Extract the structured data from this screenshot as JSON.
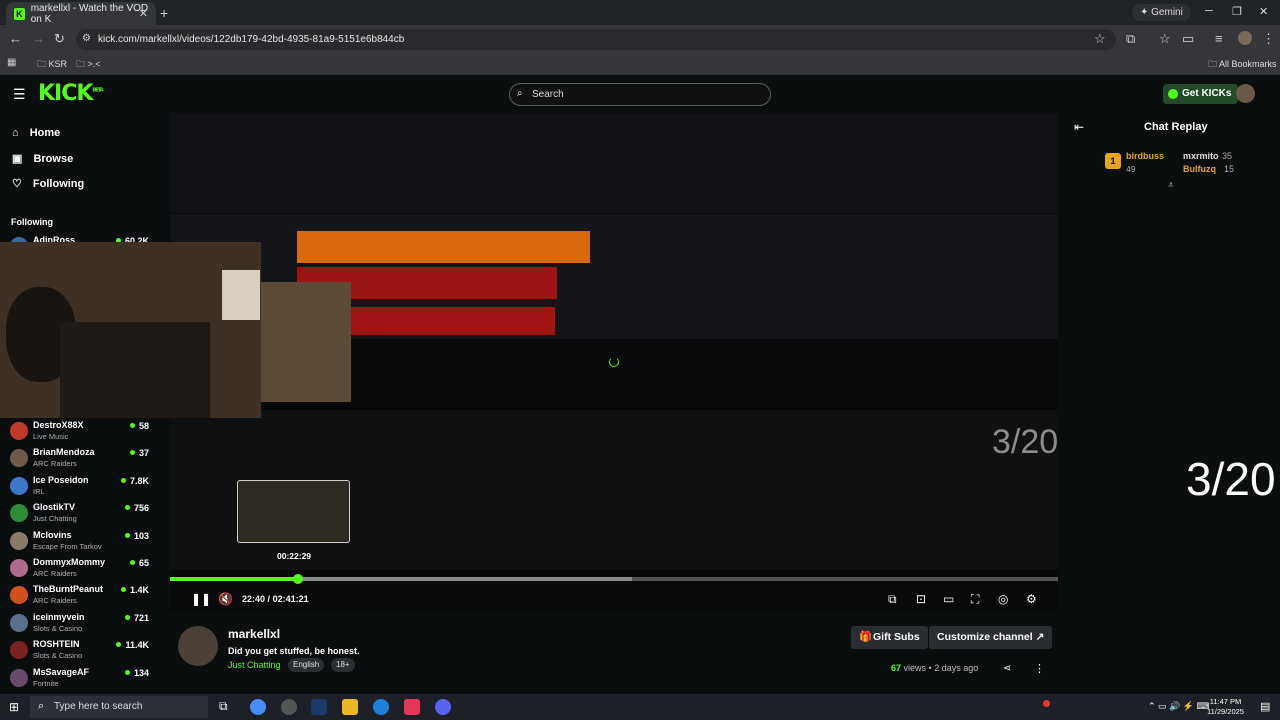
{
  "browser": {
    "tab_title": "markellxl - Watch the VOD on K",
    "tab_favicon": "K",
    "new_tab": "+",
    "gemini": "✦ Gemini",
    "url": "kick.com/markellxl/videos/122db179-42bd-4935-81a9-5151e6b844cb",
    "bookmarks": [
      "KSR",
      ">.<"
    ],
    "all_bookmarks": "All Bookmarks"
  },
  "kick": {
    "logo": "KICK",
    "logo_badge": "BETA",
    "search_placeholder": "Search",
    "get_kicks": "Get KICKs"
  },
  "sidebar": {
    "nav": [
      {
        "label": "Home",
        "icon": "home-icon"
      },
      {
        "label": "Browse",
        "icon": "browse-icon"
      },
      {
        "label": "Following",
        "icon": "heart-icon"
      }
    ],
    "section_title": "Following",
    "first_partial": {
      "name": "AdinRoss",
      "viewers": "60.2K"
    },
    "following": [
      {
        "name": "DestroX88X",
        "category": "Live Music",
        "viewers": "58",
        "color": "#c0392b"
      },
      {
        "name": "BrianMendoza",
        "category": "ARC Raiders",
        "viewers": "37",
        "color": "#6d5a4a"
      },
      {
        "name": "Ice Poseidon",
        "category": "IRL",
        "viewers": "7.8K",
        "color": "#3d78c9"
      },
      {
        "name": "GlostikTV",
        "category": "Just Chatting",
        "viewers": "756",
        "color": "#2e8b3a"
      },
      {
        "name": "Mclovins",
        "category": "Escape From Tarkov",
        "viewers": "103",
        "color": "#8a7a6a"
      },
      {
        "name": "DommyxMommy",
        "category": "ARC Raiders",
        "viewers": "65",
        "color": "#b06a8a"
      },
      {
        "name": "TheBurntPeanut",
        "category": "ARC Raiders",
        "viewers": "1.4K",
        "color": "#d0511e"
      },
      {
        "name": "iceinmyvein",
        "category": "Slots & Casino",
        "viewers": "721",
        "color": "#5a6f8a"
      },
      {
        "name": "ROSHTEIN",
        "category": "Slots & Casino",
        "viewers": "11.4K",
        "color": "#7a2222"
      },
      {
        "name": "MsSavageAF",
        "category": "Fortnite",
        "viewers": "134",
        "color": "#6a4a6a"
      }
    ]
  },
  "player": {
    "overlay_text": "3/20",
    "hover_time": "00:22:29",
    "current_time": "22:40",
    "separator": "/",
    "duration": "02:41:21",
    "progress_played": 0.14,
    "progress_buffered": 0.52
  },
  "chat": {
    "title": "Chat Replay",
    "leaders": [
      {
        "rank": "1",
        "name": "birdbuss",
        "count": "49"
      },
      {
        "name": "mxrmito",
        "count": "35"
      },
      {
        "name": "Bulfuzq",
        "count": "15"
      }
    ],
    "big_text": "3/20"
  },
  "channel": {
    "name": "markellxl",
    "stream_title": "Did you get stuffed, be honest.",
    "category": "Just Chatting",
    "tags": [
      "English",
      "18+"
    ],
    "gift_subs": "Gift Subs",
    "customize": "Customize channel",
    "views": "67",
    "views_label": "views",
    "ago": "2 days ago"
  },
  "taskbar": {
    "search_placeholder": "Type here to search",
    "time": "11:47 PM",
    "date": "11/29/2025"
  }
}
